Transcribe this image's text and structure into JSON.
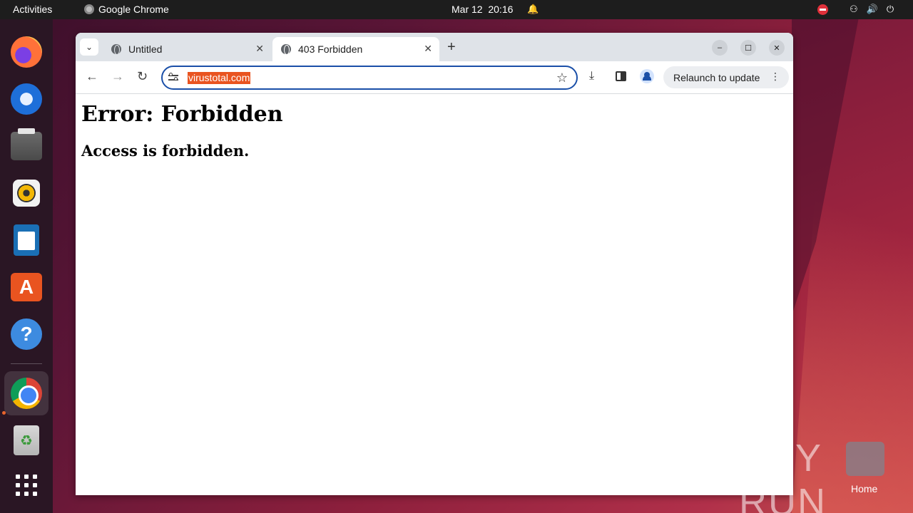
{
  "topbar": {
    "activities": "Activities",
    "app_name": "Google Chrome",
    "date": "Mar 12",
    "time": "20:16"
  },
  "dock": {
    "items": [
      "firefox",
      "thunderbird",
      "files",
      "rhythmbox",
      "libreoffice-writer",
      "app-center",
      "help",
      "google-chrome",
      "trash",
      "show-apps"
    ],
    "active": "google-chrome"
  },
  "browser": {
    "tabs": [
      {
        "title": "Untitled",
        "active": false
      },
      {
        "title": "403 Forbidden",
        "active": true
      }
    ],
    "omnibox": {
      "url": "virustotal.com"
    },
    "relaunch_label": "Relaunch to update"
  },
  "page": {
    "heading": "Error: Forbidden",
    "subheading": "Access is forbidden."
  },
  "desktop": {
    "watermark": "ANY RUN",
    "home_label": "Home"
  },
  "colors": {
    "accent": "#e95420",
    "omnibox_border": "#1a4fa8"
  }
}
